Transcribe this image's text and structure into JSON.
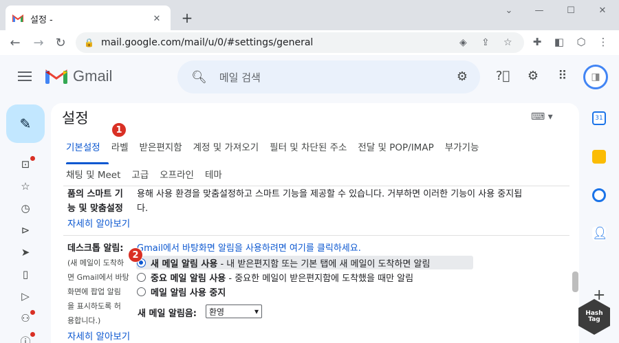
{
  "browser": {
    "tab_title": "설정 -",
    "url": "mail.google.com/mail/u/0/#settings/general",
    "new_tab": "+",
    "close_tab": "✕"
  },
  "gmail": {
    "logo_text": "Gmail",
    "search_placeholder": "메일 검색"
  },
  "settings": {
    "title": "설정",
    "tabs_row1": [
      "기본설정",
      "라벨",
      "받은편지함",
      "계정 및 가져오기",
      "필터 및 차단된 주소",
      "전달 및 POP/IMAP",
      "부가기능"
    ],
    "tabs_row2": [
      "채팅 및 Meet",
      "고급",
      "오프라인",
      "테마"
    ],
    "active_tab": "기본설정",
    "smart": {
      "label_line1": "품의 스마트 기",
      "label_line2": "능 및 맞춤설정",
      "text_line1": "용해 사용 환경을 맞춤설정하고 스마트 기능을 제공할 수 있습니다. 거부하면 이러한 기능이 사용 중지됩",
      "text_line2": "다.",
      "learn_more": "자세히 알아보기"
    },
    "desktop": {
      "label": "데스크톱 알림:",
      "link_text": "Gmail에서 바탕화면 알림을 사용하려면 여기를 클릭하세요.",
      "sub_label": [
        "(새 메일이 도착하",
        "면 Gmail에서 바탕",
        "화면에 팝업 알림",
        "을 표시하도록 허",
        "용합니다.)"
      ],
      "options": [
        {
          "bold": "새 메일 알림 사용",
          "rest": " - 내 받은편지함 또는 기본 탭에 새 메일이 도착하면 알림",
          "checked": true
        },
        {
          "bold": "중요 메일 알림 사용",
          "rest": " - 중요한 메일이 받은편지함에 도착했을 때만 알림",
          "checked": false
        },
        {
          "bold": "메일 알림 사용 중지",
          "rest": "",
          "checked": false
        }
      ],
      "sound_label": "새 메일 알림음:",
      "sound_value": "환영",
      "learn_more": "자세히 알아보기"
    },
    "badges": [
      "1",
      "2"
    ]
  },
  "watermark": "Hash Tag"
}
